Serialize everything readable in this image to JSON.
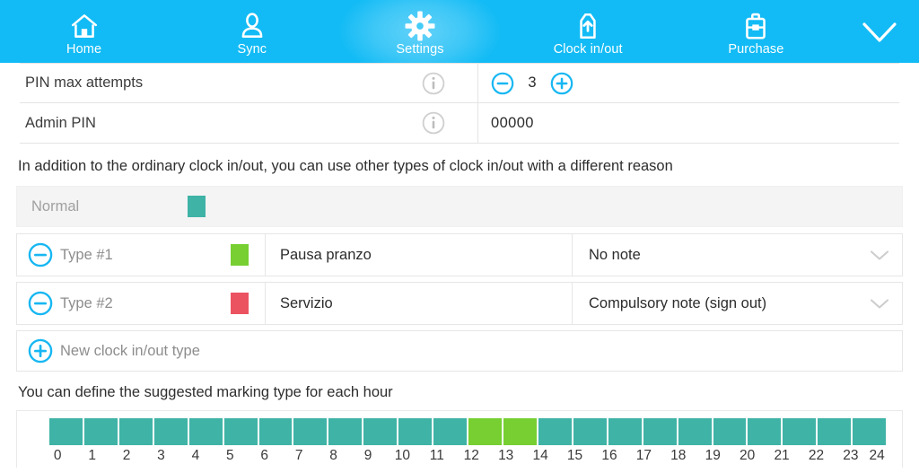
{
  "nav": {
    "items": [
      {
        "label": "Home",
        "icon": "home-icon",
        "active": false
      },
      {
        "label": "Sync",
        "icon": "person-icon",
        "active": false
      },
      {
        "label": "Settings",
        "icon": "gear-icon",
        "active": true
      },
      {
        "label": "Clock in/out",
        "icon": "clock-inout-icon",
        "active": false
      },
      {
        "label": "Purchase",
        "icon": "briefcase-icon",
        "active": false
      }
    ],
    "expand_icon": "chevron-down-icon"
  },
  "settings": {
    "rows": [
      {
        "label": "PIN max attempts",
        "info_icon": "info-icon",
        "control": "stepper",
        "value": "3",
        "minus_icon": "minus-circle-icon",
        "plus_icon": "plus-circle-icon"
      },
      {
        "label": "Admin PIN",
        "info_icon": "info-icon",
        "control": "text",
        "value": "00000"
      }
    ]
  },
  "clock_types": {
    "note": "In addition to the ordinary clock in/out, you can use other types of clock in/out with a different reason",
    "rows": [
      {
        "name": "Normal",
        "color": "#3FB3A6",
        "title": "",
        "note": "",
        "removable": false,
        "readonly": true
      },
      {
        "name": "Type #1",
        "color": "#77CF32",
        "title": "Pausa pranzo",
        "note": "No note",
        "removable": true,
        "readonly": false
      },
      {
        "name": "Type #2",
        "color": "#EC5361",
        "title": "Servizio",
        "note": "Compulsory note (sign out)",
        "removable": true,
        "readonly": false
      }
    ],
    "add_label": "New clock in/out type",
    "add_icon": "plus-circle-icon",
    "remove_icon": "minus-circle-icon",
    "dropdown_icon": "chevron-down-icon"
  },
  "hours": {
    "note": "You can define the suggested marking type for each hour",
    "ticks": [
      "0",
      "1",
      "2",
      "3",
      "4",
      "5",
      "6",
      "7",
      "8",
      "9",
      "10",
      "11",
      "12",
      "13",
      "14",
      "15",
      "16",
      "17",
      "18",
      "19",
      "20",
      "21",
      "22",
      "23",
      "24"
    ],
    "segment_colors": [
      "#3FB3A6",
      "#3FB3A6",
      "#3FB3A6",
      "#3FB3A6",
      "#3FB3A6",
      "#3FB3A6",
      "#3FB3A6",
      "#3FB3A6",
      "#3FB3A6",
      "#3FB3A6",
      "#3FB3A6",
      "#3FB3A6",
      "#77CF32",
      "#77CF32",
      "#3FB3A6",
      "#3FB3A6",
      "#3FB3A6",
      "#3FB3A6",
      "#3FB3A6",
      "#3FB3A6",
      "#3FB3A6",
      "#3FB3A6",
      "#3FB3A6",
      "#3FB3A6"
    ]
  },
  "colors": {
    "brand_blue": "#12BBF5",
    "teal": "#3FB3A6",
    "green": "#77CF32",
    "red": "#EC5361"
  }
}
